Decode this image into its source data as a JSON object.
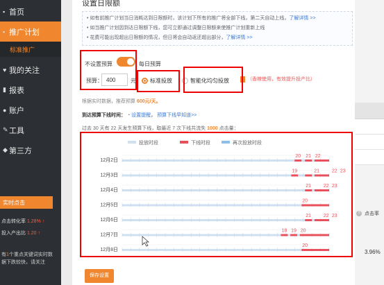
{
  "sidebar": {
    "items": [
      {
        "label": "首页"
      },
      {
        "label": "推广计划"
      },
      {
        "label": "标准推广"
      },
      {
        "label": "我的关注"
      },
      {
        "label": "报表"
      },
      {
        "label": "账户"
      },
      {
        "label": "工具"
      },
      {
        "label": "第三方"
      }
    ],
    "hot_title": "实时点击",
    "stats": [
      {
        "label": "点击转化率",
        "value": "1.28% ↑"
      },
      {
        "label": "投入产出比",
        "value": "1.20 ↑"
      }
    ],
    "message_prefix": "有",
    "message_count": "1",
    "message_rest": "个重点关键词实时数据下跌较快，请关注"
  },
  "main": {
    "title": "设置日限额",
    "tips": [
      {
        "text": "如有前推广计划当日消耗达到日限额时，该计划下所有的推广将全部下线，第二天自动上线，",
        "link": "了解详情 >>"
      },
      {
        "text": "如当推广计划因到达日限额下线，您可立即通过调整日限额来使推广计划重新上线",
        "link": ""
      },
      {
        "text": "花费可能出现超出日限额的情况，但日将会自动返还超出部分，",
        "link": "了解详情 >>"
      }
    ],
    "budget": {
      "no_limit_label": "不设置预算",
      "daily_label": "每日预算",
      "budget_label": "预算：",
      "value": "400",
      "unit": "元"
    },
    "delivery": {
      "standard_label": "标准投放",
      "smart_label": "智能化均匀投放",
      "smart_note": "（香辣使用，有效提升投产比）"
    },
    "recommend": {
      "prefix": "根据实时数据，推荐预算",
      "value": "600",
      "suffix": "元/天。"
    },
    "offline": {
      "label": "到达预算下线时间：",
      "link1": "设置提醒",
      "link2": "预算下线早知道>>"
    },
    "summary": {
      "p1": "过去 30 天有 22 天发生预算下线，取最近 7 次下线共流失",
      "clicks": "1000",
      "p2": "点击量："
    },
    "save_label": "保存设置"
  },
  "right_panel": {
    "header": "点击率",
    "value": "3.96%"
  },
  "chart_data": {
    "type": "timeline",
    "legend": [
      "投放时段",
      "下线时段",
      "再次投放时段"
    ],
    "colors": {
      "online": "#cfe0f1",
      "offline": "#e8505b",
      "restart": "#8fbfe6"
    },
    "x_ticks": [
      0,
      3,
      6,
      9,
      12,
      15,
      18,
      21,
      24
    ],
    "xlim": [
      0,
      24
    ],
    "rows": [
      {
        "date": "12月2日",
        "offline": [
          [
            20,
            20.8
          ],
          [
            21.2,
            22
          ],
          [
            22.3,
            24
          ]
        ],
        "labels": [
          "20",
          "21",
          "22"
        ]
      },
      {
        "date": "12月3日",
        "offline": [
          [
            19.6,
            20.4
          ],
          [
            21.2,
            22
          ],
          [
            22.3,
            24
          ]
        ],
        "labels": [
          "19",
          "21",
          "22",
          "23"
        ]
      },
      {
        "date": "12月4日",
        "offline": [
          [
            21.2,
            22
          ],
          [
            22.3,
            24
          ]
        ],
        "labels": [
          "21",
          "22",
          "23"
        ]
      },
      {
        "date": "12月5日",
        "offline": [
          [
            20.8,
            24
          ]
        ],
        "labels": [
          "20"
        ]
      },
      {
        "date": "12月6日",
        "offline": [
          [
            21.2,
            22
          ],
          [
            22.3,
            24
          ]
        ],
        "labels": [
          "21",
          "22",
          "23"
        ]
      },
      {
        "date": "12月7日",
        "offline": [
          [
            18.4,
            19.2
          ],
          [
            19.5,
            20.3
          ],
          [
            20.6,
            24
          ]
        ],
        "labels": [
          "18",
          "19",
          "20"
        ]
      },
      {
        "date": "12月8日",
        "offline": [
          [
            20.8,
            24
          ]
        ],
        "labels": [
          "20"
        ]
      }
    ]
  }
}
